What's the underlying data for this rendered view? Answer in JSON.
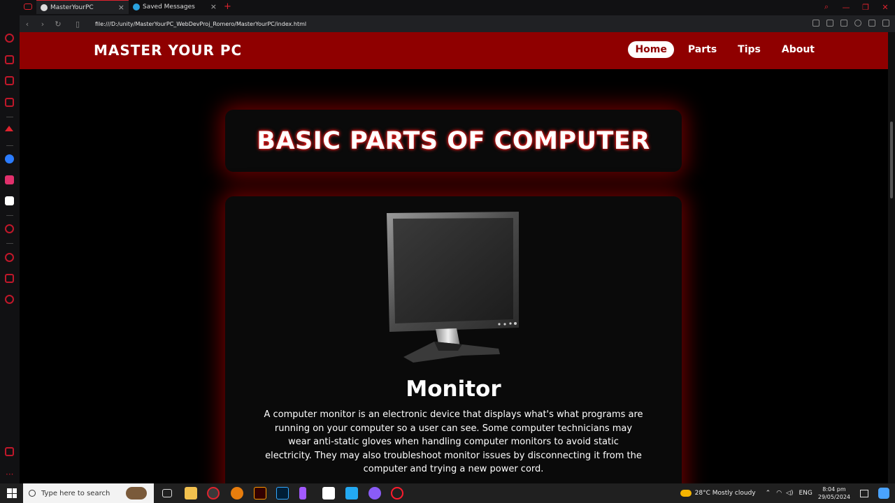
{
  "browser": {
    "tabs": [
      {
        "title": "MasterYourPC",
        "active": true
      },
      {
        "title": "Saved Messages",
        "active": false
      }
    ],
    "new_tab_glyph": "+",
    "url": "file:///D:/unity/MasterYourPC_WebDevProj_Romero/MasterYourPC/index.html"
  },
  "site": {
    "brand": "MASTER YOUR PC",
    "nav": [
      {
        "label": "Home",
        "active": true
      },
      {
        "label": "Parts",
        "active": false
      },
      {
        "label": "Tips",
        "active": false
      },
      {
        "label": "About",
        "active": false
      }
    ],
    "page_title": "BASIC PARTS OF COMPUTER",
    "part": {
      "name": "Monitor",
      "description": "A computer monitor is an electronic device that displays what's what programs are running on your computer so a user can see. Some computer technicians may wear anti-static gloves when handling computer monitors to avoid static electricity. They may also troubleshoot monitor issues by disconnecting it from the computer and trying a new power cord."
    }
  },
  "taskbar": {
    "search_placeholder": "Type here to search",
    "weather": "28°C  Mostly cloudy",
    "language": "ENG",
    "time": "8:04 pm",
    "date": "29/05/2024"
  },
  "colors": {
    "header_red": "#8f0000",
    "glow_red": "#c80000",
    "accent_red": "#e0232e"
  }
}
